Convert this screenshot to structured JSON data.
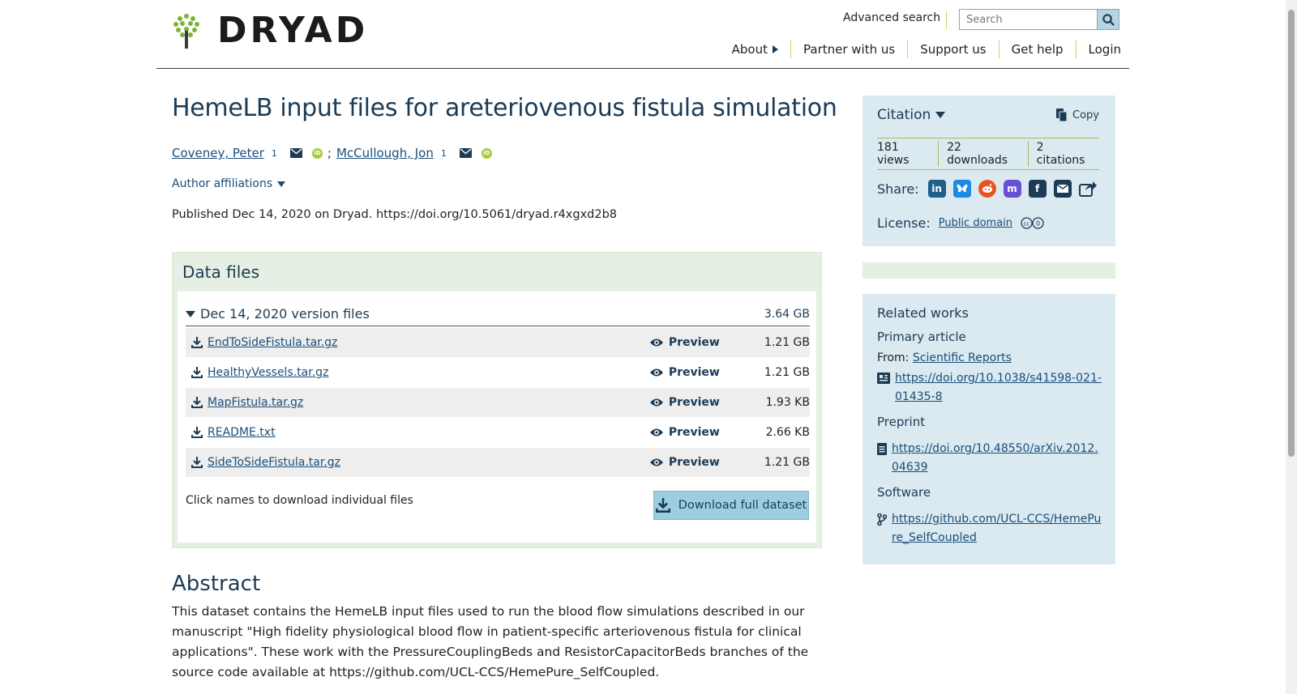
{
  "header": {
    "logo_text": "DRYAD",
    "advanced_search": "Advanced search",
    "search_placeholder": "Search",
    "nav": [
      "About",
      "Partner with us",
      "Support us",
      "Get help",
      "Login"
    ]
  },
  "dataset": {
    "title": "HemeLB input files for areteriovenous fistula simulation",
    "authors": [
      {
        "name": "Coveney, Peter",
        "affil": "1"
      },
      {
        "name": "McCullough, Jon",
        "affil": "1"
      }
    ],
    "author_separator": ";",
    "affiliations_toggle": "Author affiliations",
    "published": "Published Dec 14, 2020 on Dryad. https://doi.org/10.5061/dryad.r4xgxd2b8"
  },
  "files": {
    "heading": "Data files",
    "version_label": "Dec 14, 2020 version files",
    "version_size": "3.64 GB",
    "preview_label": "Preview",
    "list": [
      {
        "name": "EndToSideFistula.tar.gz",
        "size": "1.21 GB"
      },
      {
        "name": "HealthyVessels.tar.gz",
        "size": "1.21 GB"
      },
      {
        "name": "MapFistula.tar.gz",
        "size": "1.93 KB"
      },
      {
        "name": "README.txt",
        "size": "2.66 KB"
      },
      {
        "name": "SideToSideFistula.tar.gz",
        "size": "1.21 GB"
      }
    ],
    "hint": "Click names to download individual files",
    "download_all": "Download full dataset"
  },
  "abstract": {
    "heading": "Abstract",
    "text": "This dataset contains the HemeLB input files used to run the blood flow simulations described in our manuscript \"High fidelity physiological blood flow in patient-specific arteriovenous fistula for clinical applications\". These work with the PressureCouplingBeds and ResistorCapacitorBeds branches of the source code available at https://github.com/UCL-CCS/HemePure_SelfCoupled."
  },
  "citation": {
    "label": "Citation",
    "copy": "Copy",
    "views": "181 views",
    "downloads": "22 downloads",
    "citations": "2 citations",
    "share_label": "Share:",
    "license_label": "License:",
    "license_value": "Public domain"
  },
  "related": {
    "heading": "Related works",
    "primary_label": "Primary article",
    "from_label": "From:",
    "from_journal": "Scientific Reports",
    "primary_link": "https://doi.org/10.1038/s41598-021-01435-8",
    "preprint_label": "Preprint",
    "preprint_link": "https://doi.org/10.48550/arXiv.2012.04639",
    "software_label": "Software",
    "software_link": "https://github.com/UCL-CCS/HemePure_SelfCoupled"
  },
  "colors": {
    "accent_blue": "#1c3b55",
    "link": "#1a4e7a",
    "panel_green": "#e6efe3",
    "sidebar_blue": "#dbe9f0",
    "divider_lime": "#a7c05a"
  }
}
